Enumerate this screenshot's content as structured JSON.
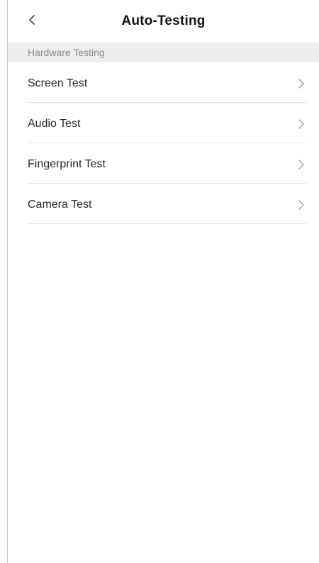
{
  "header": {
    "title": "Auto-Testing",
    "back_icon": "chevron-left-icon"
  },
  "section": {
    "label": "Hardware Testing"
  },
  "items": [
    {
      "label": "Screen Test",
      "icon": "chevron-right-icon"
    },
    {
      "label": "Audio Test",
      "icon": "chevron-right-icon"
    },
    {
      "label": "Fingerprint Test",
      "icon": "chevron-right-icon"
    },
    {
      "label": "Camera Test",
      "icon": "chevron-right-icon"
    }
  ],
  "colors": {
    "section_background": "#eeeeee",
    "section_text": "#888888",
    "divider": "#e3e3e3",
    "chevron": "#9a9a9a"
  }
}
